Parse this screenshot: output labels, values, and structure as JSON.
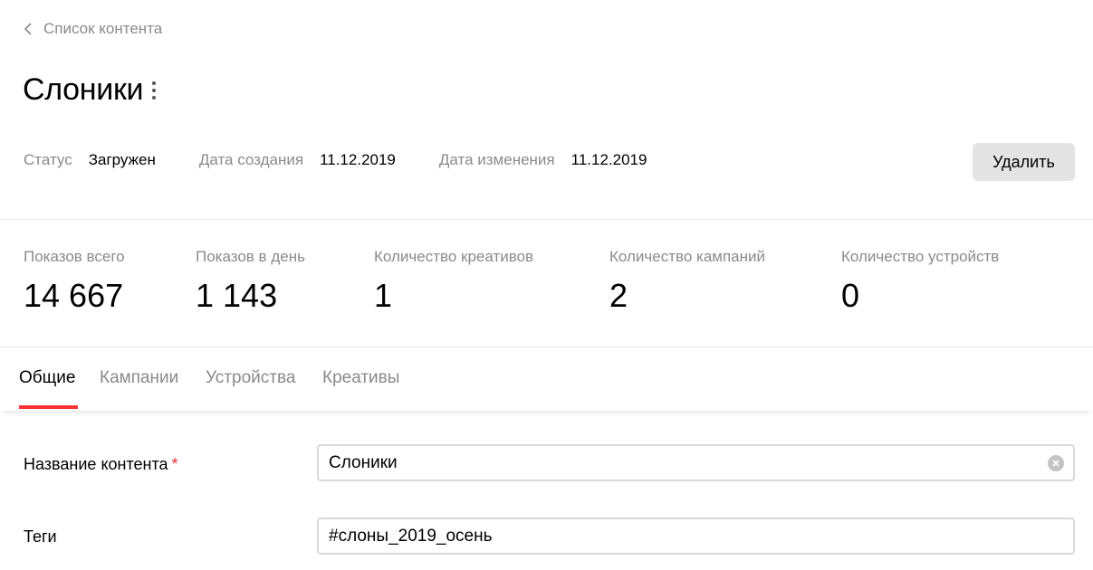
{
  "nav": {
    "back_label": "Список контента",
    "back_icon": "chevron-left-icon"
  },
  "header": {
    "title": "Слоники",
    "menu_icon": "kebab-menu-icon"
  },
  "meta": {
    "status_label": "Статус",
    "status_value": "Загружен",
    "created_label": "Дата создания",
    "created_value": "11.12.2019",
    "modified_label": "Дата изменения",
    "modified_value": "11.12.2019",
    "delete_label": "Удалить"
  },
  "stats": [
    {
      "label": "Показов всего",
      "value": "14 667"
    },
    {
      "label": "Показов в день",
      "value": "1 143"
    },
    {
      "label": "Количество креативов",
      "value": "1"
    },
    {
      "label": "Количество кампаний",
      "value": "2"
    },
    {
      "label": "Количество устройств",
      "value": "0"
    }
  ],
  "tabs": [
    {
      "label": "Общие",
      "active": true
    },
    {
      "label": "Кампании",
      "active": false
    },
    {
      "label": "Устройства",
      "active": false
    },
    {
      "label": "Креативы",
      "active": false
    }
  ],
  "form": {
    "name_label": "Название контента",
    "required_mark": "*",
    "name_value": "Слоники",
    "clear_icon": "clear-circle-icon",
    "tags_label": "Теги",
    "tags_value": "#слоны_2019_осень"
  },
  "colors": {
    "accent": "#ff3333",
    "muted_text": "#8a8a8a",
    "button_bg": "#e4e4e4"
  }
}
